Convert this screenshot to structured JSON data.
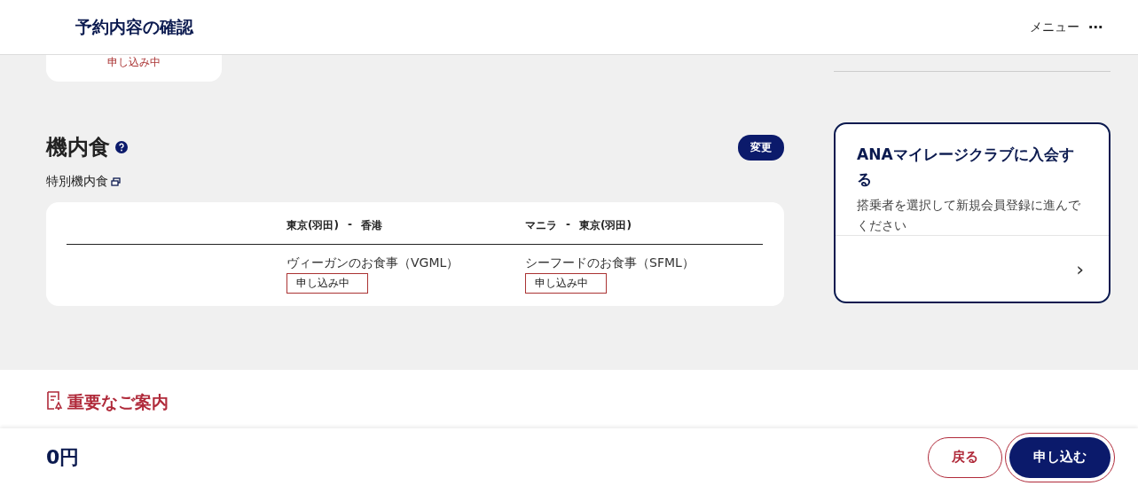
{
  "header": {
    "title": "予約内容の確認",
    "menu_label": "メニュー",
    "menu_icon": "⋯"
  },
  "top_card": {
    "status": "申し込み中"
  },
  "meal_section": {
    "title": "機内食",
    "change_button": "変更",
    "subtitle": "特別機内食",
    "columns": [
      {
        "route_from": "東京(羽田)",
        "route_to": "香港",
        "meal": "ヴィーガンのお食事（VGML）",
        "status": "申し込み中",
        "highlighted": true
      },
      {
        "route_from": "マニラ",
        "route_to": "東京(羽田)",
        "meal": "シーフードのお食事（SFML）",
        "status": "申し込み中",
        "highlighted": true
      }
    ],
    "route_separator": "-"
  },
  "mileage_card": {
    "title": "ANAマイレージクラブに入会する",
    "description": "搭乗者を選択して新規会員登録に進んでください",
    "chevron": "›"
  },
  "notice": {
    "title": "重要なご案内"
  },
  "footer": {
    "total": "0円",
    "buttons": [
      {
        "label": "戻る",
        "kind": "secondary",
        "highlighted": false
      },
      {
        "label": "申し込む",
        "kind": "primary",
        "highlighted": true
      }
    ]
  }
}
